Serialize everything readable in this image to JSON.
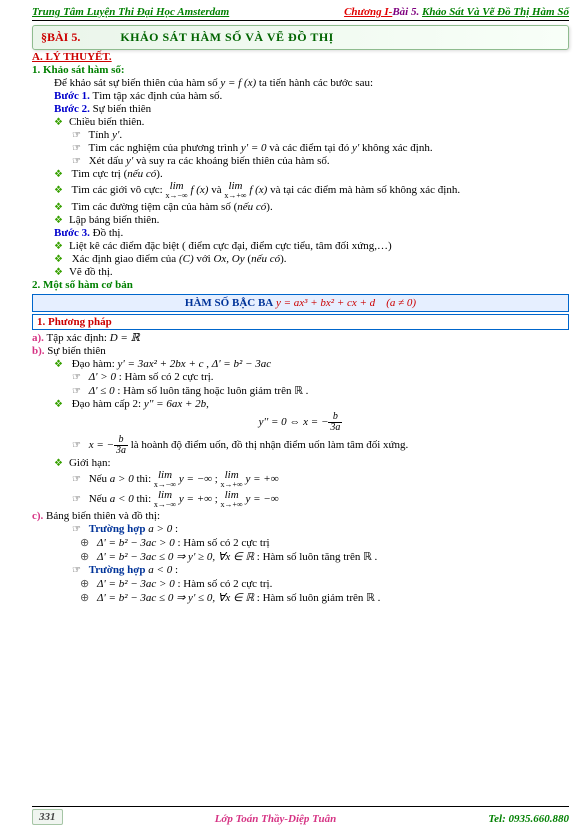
{
  "header": {
    "org": "Trung Tâm Luyện Thi Đại Học Amsterdam",
    "chapter": "Chương I-",
    "bai": "Bài 5.",
    "subtitle": "Khảo Sát Và Vẽ Đồ Thị Hàm Số"
  },
  "title": {
    "label": "§BÀI 5.",
    "text": "KHẢO SÁT HÀM SỐ VÀ VẼ ĐỒ THỊ"
  },
  "sections": {
    "A": "A. LÝ THUYẾT.",
    "s1": "1. Khảo sát hàm số:",
    "intro_a": "Để khảo sát sự biến thiên của hàm số ",
    "intro_eq": "y = f (x)",
    "intro_b": " ta tiến hành các bước sau:",
    "buoc1_l": "Bước 1.",
    "buoc1_t": " Tìm tập xác định của hàm số.",
    "buoc2_l": "Bước 2.",
    "buoc2_t": " Sự biến thiên",
    "b2_chieu": "Chiều biến thiên.",
    "b2_tinh": "Tính ",
    "b2_tinh_eq": "y'",
    "b2_tinh_dot": ".",
    "b2_nghiem_a": "Tìm các nghiệm của phương trình ",
    "b2_nghiem_eq": "y' = 0",
    "b2_nghiem_b": " và các điểm tại đó ",
    "b2_nghiem_c": "y'",
    "b2_nghiem_d": " không xác định.",
    "b2_xet_a": "Xét dấu ",
    "b2_xet_eq": "y'",
    "b2_xet_b": " và suy ra các khoảng biến thiên của hàm số.",
    "b2_cuctri": "Tìm cực trị (",
    "b2_neuco": "nếu có",
    "b2_cuctri_end": ").",
    "b2_gioivo_a": "Tìm các giới vô cực: ",
    "b2_gioivo_b": " và ",
    "b2_gioivo_c": " và tại các điểm mà hàm số không xác định.",
    "b2_tiemcan": "Tìm các đường tiệm cận của hàm số (",
    "b2_tiemcan_end": ").",
    "b2_bang": "Lập bảng biến thiên.",
    "buoc3_l": "Bước 3.",
    "buoc3_t": " Đồ thị.",
    "b3_1": "Liệt kê các điểm đặc biệt ( điểm cực đại, điểm cực tiểu, tâm đối xứng,…)",
    "b3_2a": "Xác định giao điểm của ",
    "b3_2b": "(C)",
    "b3_2c": " với ",
    "b3_2d": "Ox, Oy",
    "b3_2e": " (",
    "b3_2f": ").",
    "b3_3": "Vẽ đồ thị.",
    "s2": "2. Một số hàm cơ bản",
    "fn_title": "HÀM SỐ BẬC BA",
    "fn_eq": " y = ax³ + bx² + cx + d ",
    "fn_cond": "(a ≠ 0)",
    "pp": "1.  Phương pháp",
    "a_lbl": "a).",
    "a_txt": " Tập xác định: ",
    "a_eq": "D = ℝ",
    "b_lbl": "b).",
    "b_txt": " Sự biến thiên",
    "dh_lbl": "Đạo hàm: ",
    "dh_eq": "y' = 3ax² + 2bx + c",
    "dh_sep": " , ",
    "dh_delta": "Δ' = b² − 3ac",
    "dgt0_l": "Δ' > 0",
    "dgt0_t": " : Hàm số có 2 cực trị.",
    "dle0_l": "Δ' ≤ 0",
    "dle0_t": " : Hàm số luôn tăng hoặc luôn giảm trên ℝ .",
    "dh2_l": "Đạo hàm cấp 2: ",
    "dh2_eq": "y'' = 6ax + 2b",
    "dh2_eq2": ",",
    "y2eq": " y'' = 0 ⇔ x = −",
    "frac_b": "b",
    "frac_3a": "3a",
    "uon_a": " x = −",
    "uon_b": " là hoành độ điểm uốn, đồ thị nhận điểm uốn làm tâm đối xứng.",
    "gh": "Giới hạn:",
    "gh_a1": "Nếu ",
    "gh_apos": "a > 0",
    "gh_aneg": "a < 0",
    "gh_thi": " thì: ",
    "gh_sep": "; ",
    "c_lbl": "c).",
    "c_txt": " Bảng biến thiên và đồ thị:",
    "th_a_pos": "Trường hợp ",
    "th_apos_eq": "a > 0",
    "th_aneg_eq": "a < 0",
    "colon": " :",
    "case1_eq": "Δ' = b² − 3ac > 0",
    "case1_t": " : Hàm số có 2 cực trị",
    "case2_eq": "Δ' = b² − 3ac ≤ 0 ⇒ y' ≥ 0, ∀x ∈ ℝ",
    "case2_t": " : Hàm số luôn tăng trên ℝ .",
    "case3_eq": "Δ' = b² − 3ac > 0",
    "case3_t": " : Hàm số có 2 cực trị.",
    "case4_eq": "Δ' = b² − 3ac ≤ 0 ⇒ y' ≤ 0, ∀x ∈ ℝ",
    "case4_t": " : Hàm số luôn giảm trên ℝ ."
  },
  "limits": {
    "lim_lbl": "lim",
    "x_neg": "x→−∞",
    "x_pos": "x→+∞",
    "fx": "f (x)",
    "y": "y",
    "eq_neg": " = −∞",
    "eq_pos": " = +∞"
  },
  "footer": {
    "page": "331",
    "center": "Lớp Toán Thầy-Diệp Tuân",
    "right": "Tel: 0935.660.880"
  }
}
